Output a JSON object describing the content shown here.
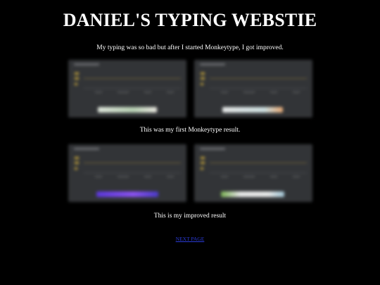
{
  "page": {
    "title": "DANIEL'S TYPING WEBSTIE",
    "intro": "My typing was so bad but after I started Monkeytype, I got improved.",
    "caption_first": "This was my first Monkeytype result.",
    "caption_improved": "This is my improved result",
    "next_link": "NEXT PAGE"
  },
  "colors": {
    "background": "#000000",
    "text": "#ffffff",
    "link": "#2a3bd6"
  }
}
